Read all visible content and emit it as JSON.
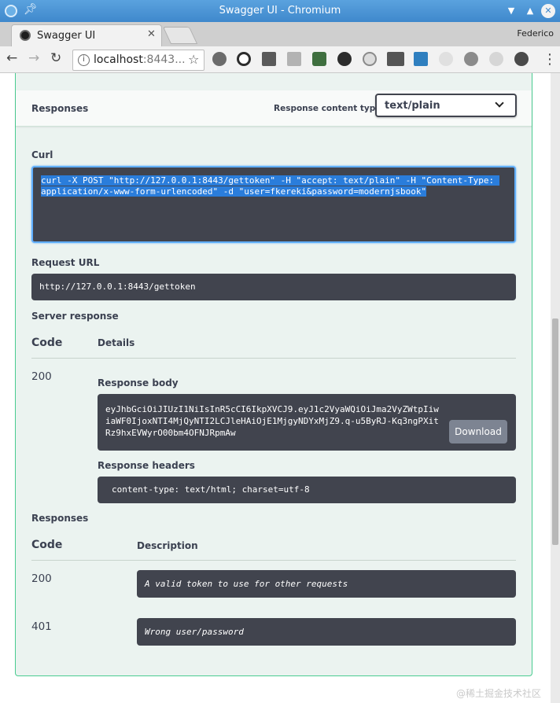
{
  "window": {
    "title": "Swagger UI - Chromium"
  },
  "tabs": [
    {
      "label": "Swagger UI"
    }
  ],
  "profile": "Federico",
  "address_bar": {
    "host": "localhost",
    "rest": ":8443..."
  },
  "swagger": {
    "responses_label": "Responses",
    "response_content_type_label": "Response content type",
    "content_type_value": "text/plain",
    "curl_label": "Curl",
    "curl_command": "curl -X POST \"http://127.0.0.1:8443/gettoken\" -H \"accept: text/plain\" -H \"Content-Type: application/x-www-form-urlencoded\" -d \"user=fkereki&password=modernjsbook\"",
    "request_url_label": "Request URL",
    "request_url": "http://127.0.0.1:8443/gettoken",
    "server_response_label": "Server response",
    "col_code": "Code",
    "col_details": "Details",
    "server_code": "200",
    "response_body_label": "Response body",
    "response_body": "eyJhbGciOiJIUzI1NiIsInR5cCI6IkpXVCJ9.eyJ1c2VyaWQiOiJma2VyZWtpIiwiaWF0IjoxNTI4MjQyNTI2LCJleHAiOjE1MjgyNDYxMjZ9.q-u5ByRJ-Kq3ngPXitRz9hxEVWyrO00bm4OFNJRpmAw",
    "download_label": "Download",
    "response_headers_label": "Response headers",
    "response_headers": "content-type: text/html; charset=utf-8",
    "responses_section_label": "Responses",
    "col_description": "Description",
    "responses": [
      {
        "code": "200",
        "description": "A valid token to use for other requests"
      },
      {
        "code": "401",
        "description": "Wrong user/password"
      }
    ]
  },
  "watermark": "@稀土掘金技术社区"
}
